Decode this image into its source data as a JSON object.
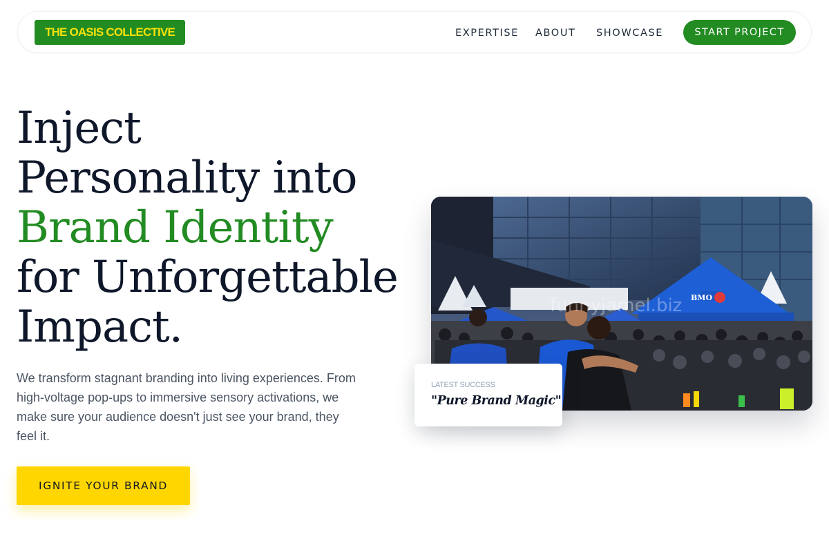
{
  "nav": {
    "logo": "THE OASIS COLLECTIVE",
    "links": [
      "EXPERTISE",
      "ABOUT",
      "SHOWCASE"
    ],
    "cta": "START PROJECT"
  },
  "hero": {
    "headline": {
      "line1": "Inject",
      "line2": "Personality into",
      "line3": "Brand Identity",
      "line4": "for Unforgettable",
      "line5": "Impact."
    },
    "subtext": "We transform stagnant branding into living experiences. From high-voltage pop-ups to immersive sensory activations, we make sure your audience doesn't just see your brand, they feel it.",
    "cta": "IGNITE YOUR BRAND",
    "image_banner": "BMO",
    "watermark": "funnyjamel.biz",
    "badge": {
      "label": "LATEST SUCCESS",
      "quote": "\"Pure Brand Magic\""
    }
  },
  "colors": {
    "brand_green": "#228b22",
    "brand_yellow": "#ffd600",
    "text_dark": "#0f172a",
    "text_muted": "#4b5563"
  }
}
